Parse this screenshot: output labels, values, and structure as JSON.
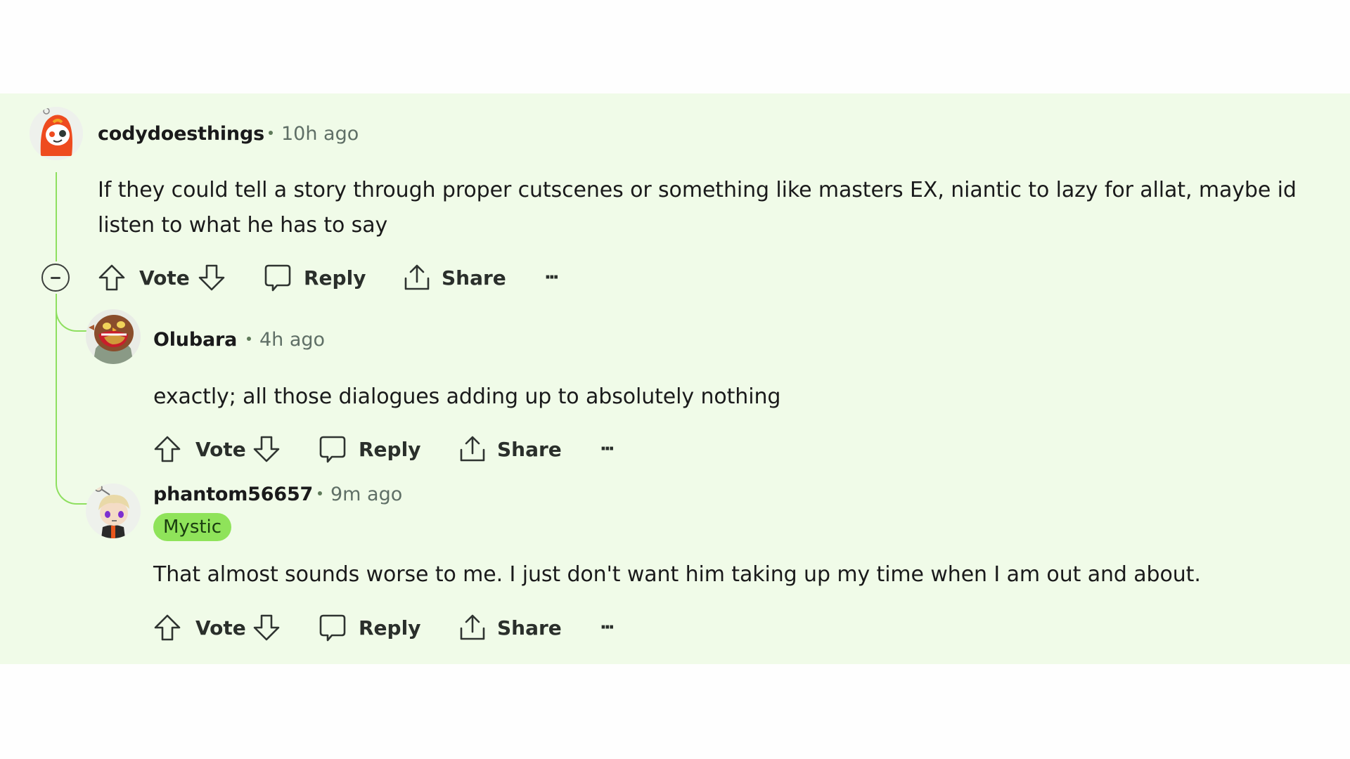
{
  "theme": {
    "thread_background": "#f0fbe8",
    "thread_line": "#8edf5f",
    "flair_background": "#8fe35a"
  },
  "comments": [
    {
      "username": "codydoesthings",
      "time": "10h ago",
      "avatar_icon": "snoo-avatar-red-hood",
      "body_lines": [
        "If they could tell a story through proper cutscenes or something like masters EX, niantic to lazy for allat, maybe id",
        "listen to what he has to say"
      ],
      "actions": {
        "vote": "Vote",
        "reply": "Reply",
        "share": "Share",
        "more": "···"
      }
    },
    {
      "username": "Olubara",
      "time": "4h ago",
      "avatar_icon": "owl-avatar",
      "body_lines": [
        "exactly; all those dialogues adding up to absolutely nothing"
      ],
      "actions": {
        "vote": "Vote",
        "reply": "Reply",
        "share": "Share",
        "more": "···"
      }
    },
    {
      "username": "phantom56657",
      "time": "9m ago",
      "flair": "Mystic",
      "avatar_icon": "snoo-avatar-blonde",
      "body_lines": [
        "That almost sounds worse to me. I just don't want him taking up my time when I am out and about."
      ],
      "actions": {
        "vote": "Vote",
        "reply": "Reply",
        "share": "Share",
        "more": "···"
      }
    }
  ]
}
